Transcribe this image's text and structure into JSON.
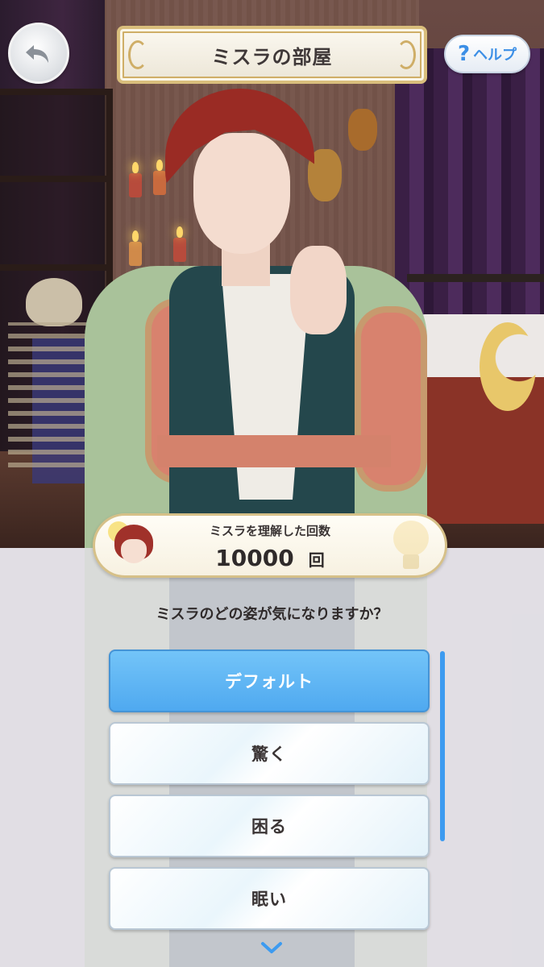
{
  "header": {
    "back_icon": "back-arrow-icon",
    "title": "ミスラの部屋",
    "help": {
      "icon": "question-mark-icon",
      "label": "ヘルプ"
    }
  },
  "counter": {
    "label": "ミスラを理解した回数",
    "value": "10000",
    "unit": "回"
  },
  "question": "ミスラのどの姿が気になりますか？",
  "options": [
    {
      "label": "デフォルト",
      "selected": true
    },
    {
      "label": "驚く",
      "selected": false
    },
    {
      "label": "困る",
      "selected": false
    },
    {
      "label": "眠い",
      "selected": false
    }
  ],
  "scroll_hint_icon": "chevron-down-icon",
  "colors": {
    "accent": "#4fa9f0",
    "help_text": "#3c8fe6",
    "title_border": "#d9be7c",
    "scrollbar": "#3d9bf0"
  }
}
